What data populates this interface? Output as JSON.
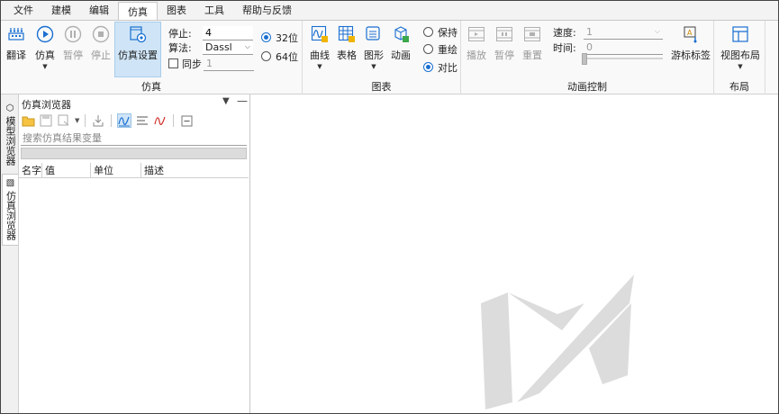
{
  "menu": [
    "文件",
    "建模",
    "编辑",
    "仿真",
    "图表",
    "工具",
    "帮助与反馈"
  ],
  "ribbon": {
    "sim_group": {
      "label": "仿真",
      "translate": "翻译",
      "simulate": "仿真",
      "pause": "暂停",
      "stop": "停止",
      "settings": "仿真设置",
      "stop_time_label": "停止:",
      "stop_time_value": "4",
      "algorithm_label": "算法:",
      "algorithm_value": "Dassl",
      "sync_label": "同步",
      "sync_value": "1",
      "bit32": "32位",
      "bit64": "64位"
    },
    "chart_group": {
      "label": "图表",
      "curve": "曲线",
      "table": "表格",
      "shape": "图形",
      "animation": "动画",
      "keep": "保持",
      "redraw": "重绘",
      "compare": "对比"
    },
    "anim_group": {
      "label": "动画控制",
      "play": "播放",
      "pause": "暂停",
      "reset": "重置",
      "speed_label": "速度:",
      "speed_value": "1",
      "time_label": "时间:",
      "time_value": "0",
      "cursor_tag": "游标标签"
    },
    "layout_group": {
      "label": "布局",
      "view_layout": "视图布局"
    }
  },
  "sidetabs": [
    "模型浏览器",
    "仿真浏览器"
  ],
  "panel": {
    "title": "仿真浏览器",
    "search_placeholder": "搜索仿真结果变量",
    "columns": [
      "名字",
      "值",
      "单位",
      "描述"
    ]
  },
  "colors": {
    "accent": "#1a6fd1",
    "selected_bg": "#cfe5f7"
  }
}
